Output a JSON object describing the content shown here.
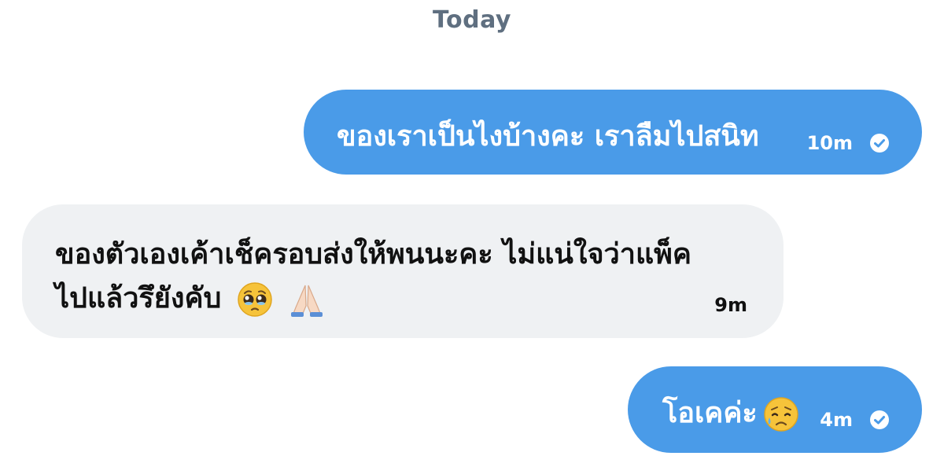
{
  "day_separator": "Today",
  "messages": [
    {
      "direction": "outgoing",
      "text": "ของเราเป็นไงบ้างคะ เราลืมไปสนิท",
      "time": "10m",
      "status_icon": "sent-check-icon"
    },
    {
      "direction": "incoming",
      "text_line1": "ของตัวเองเค้าเช็ครอบส่งให้พนนะคะ ไม่แน่ใจว่าแพ็ค",
      "text_line2": "ไปแล้วรึยังคับ",
      "emojis": [
        "pleading-face-emoji",
        "folded-hands-emoji"
      ],
      "time": "9m"
    },
    {
      "direction": "outgoing",
      "text": "โอเคค่ะ",
      "emojis": [
        "sad-relieved-face-emoji"
      ],
      "time": "4m",
      "status_icon": "sent-check-icon"
    }
  ],
  "colors": {
    "outgoing_bubble": "#4a9be8",
    "incoming_bubble": "#eff1f3",
    "day_label": "#5f6f80"
  }
}
